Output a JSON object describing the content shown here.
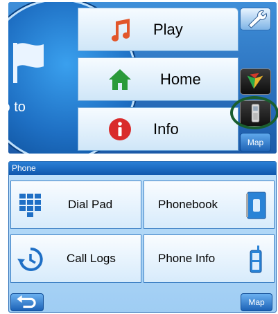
{
  "main_menu": {
    "goto_label": "Go to",
    "items": [
      {
        "label": "Play",
        "icon": "music-note-icon"
      },
      {
        "label": "Home",
        "icon": "house-icon"
      },
      {
        "label": "Info",
        "icon": "info-icon"
      }
    ],
    "side": {
      "settings_icon": "wrench-icon",
      "logo_icon": "brand-logo-icon",
      "phone_icon": "mobile-phone-icon",
      "map_label": "Map"
    },
    "highlight_color": "#1a5e2f"
  },
  "phone_screen": {
    "header": "Phone",
    "tiles": [
      {
        "label": "Dial Pad",
        "icon": "keypad-icon"
      },
      {
        "label": "Phonebook",
        "icon": "phonebook-icon"
      },
      {
        "label": "Call Logs",
        "icon": "call-history-icon"
      },
      {
        "label": "Phone Info",
        "icon": "mobile-phone-icon"
      }
    ],
    "back_icon": "back-arrow-icon",
    "map_label": "Map"
  },
  "colors": {
    "accent_blue": "#1c62b6",
    "play_icon": "#e2562a",
    "home_icon": "#2a9a3a",
    "info_icon": "#d92b2b"
  }
}
